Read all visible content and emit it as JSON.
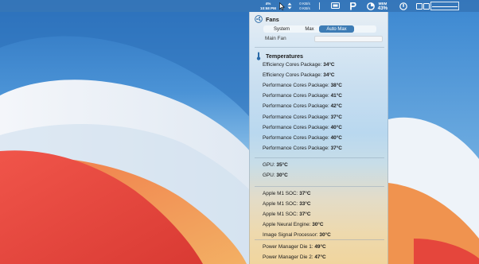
{
  "colors": {
    "accent": "#3d7cb5",
    "wallpaper_top": "#2f78c4",
    "wallpaper_red": "#e8473d",
    "wallpaper_white": "#eef1f6"
  },
  "menubar": {
    "cpu": {
      "line1": "4%",
      "line2": "10:58 PM"
    },
    "net": {
      "up": "0 KB/s",
      "down": "0 KB/s"
    },
    "mem": {
      "label": "MEM",
      "value": "43%"
    },
    "icons": [
      "display-icon",
      "p-icon",
      "stats-icon",
      "power-icon",
      "indicator-icon",
      "indicator-icon",
      "graph-icon"
    ]
  },
  "fans": {
    "title": "Fans",
    "modes": [
      "System",
      "Max",
      "Auto Max"
    ],
    "selected_mode": "Auto Max",
    "main_fan_label": "Main Fan"
  },
  "temperatures": {
    "title": "Temperatures",
    "groups": [
      [
        {
          "label": "Efficiency Cores Package:",
          "value": "34°C"
        },
        {
          "label": "Efficiency Cores Package:",
          "value": "34°C"
        },
        {
          "label": "Performance Cores Package:",
          "value": "38°C"
        },
        {
          "label": "Performance Cores Package:",
          "value": "41°C"
        },
        {
          "label": "Performance Cores Package:",
          "value": "42°C"
        },
        {
          "label": "Performance Cores Package:",
          "value": "37°C"
        },
        {
          "label": "Performance Cores Package:",
          "value": "40°C"
        },
        {
          "label": "Performance Cores Package:",
          "value": "40°C"
        },
        {
          "label": "Performance Cores Package:",
          "value": "37°C"
        }
      ],
      [
        {
          "label": "GPU:",
          "value": "35°C"
        },
        {
          "label": "GPU:",
          "value": "30°C"
        }
      ],
      [
        {
          "label": "Apple M1 SOC:",
          "value": "37°C"
        },
        {
          "label": "Apple M1 SOC:",
          "value": "33°C"
        },
        {
          "label": "Apple M1 SOC:",
          "value": "37°C"
        },
        {
          "label": "Apple Neural Engine:",
          "value": "30°C"
        },
        {
          "label": "Image Signal Processor:",
          "value": "30°C"
        }
      ],
      [
        {
          "label": "Power Manager Die 1:",
          "value": "49°C"
        },
        {
          "label": "Power Manager Die 2:",
          "value": "47°C"
        }
      ]
    ]
  }
}
